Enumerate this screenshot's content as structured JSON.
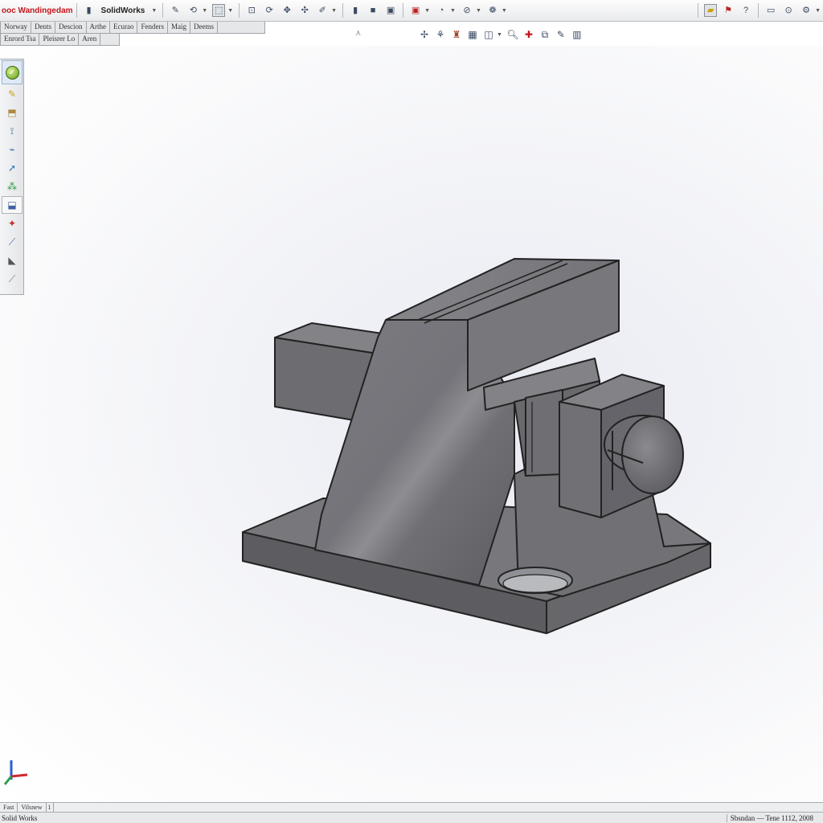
{
  "app": {
    "brand": "ooc Wandingedam",
    "document_title": "SolidWorks"
  },
  "command_tabs_row1": [
    "Norway",
    "Dents",
    "Descion",
    "Arthe",
    "Ecurao",
    "Fenders",
    "Maig",
    "Deems"
  ],
  "command_tabs_row2": [
    "Enrord Tsa",
    "Pleisrer Lo",
    "Aren"
  ],
  "status": {
    "left": "Solid Works",
    "right": "Sbsndan — Tene 1112, 2008"
  },
  "sheet_tabs": [
    "Fast",
    "Vilsnew",
    "1"
  ],
  "icons": {
    "toolbar": [
      "new-document",
      "open",
      "save",
      "print",
      "undo",
      "select",
      "rebuild",
      "options",
      "zoom",
      "cube",
      "settings",
      "view-orient",
      "section",
      "display-style",
      "hide-show",
      "appearance",
      "scene"
    ],
    "headsup": [
      "zoom-to-fit",
      "zoom-area",
      "previous-view",
      "section-view",
      "view-orientation",
      "display-style",
      "search",
      "add",
      "hide-show",
      "edit-appearance",
      "apply-scene"
    ],
    "left_toolbar": [
      "ok-check",
      "sketch",
      "extrude",
      "revolve",
      "sweep",
      "loft",
      "fillet",
      "chamfer",
      "rib",
      "shell",
      "mirror"
    ]
  },
  "colors": {
    "brand": "#c4161c",
    "model_face": "#6f6f73",
    "model_edge": "#222222",
    "viewport_center": "#e9ebf2"
  }
}
